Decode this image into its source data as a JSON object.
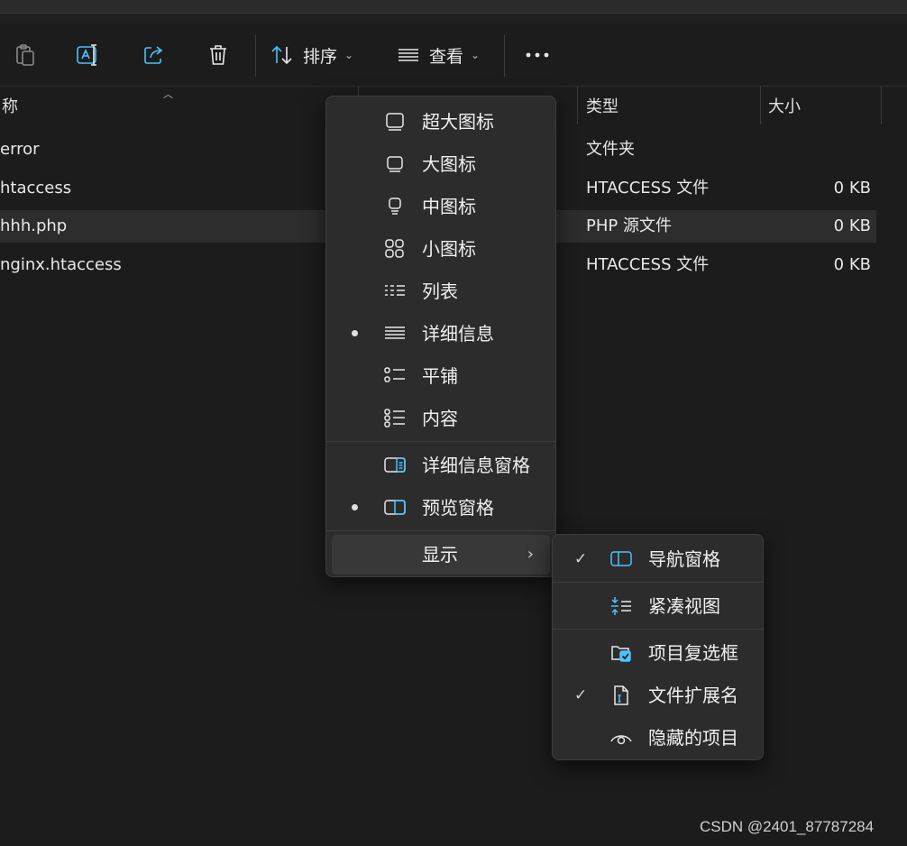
{
  "toolbar": {
    "sort_label": "排序",
    "view_label": "查看"
  },
  "columns": {
    "name": "称",
    "type": "类型",
    "size": "大小"
  },
  "files": [
    {
      "name": "error",
      "type": "文件夹",
      "size": ""
    },
    {
      "name": "htaccess",
      "type": "HTACCESS 文件",
      "size": "0 KB"
    },
    {
      "name": "hhh.php",
      "type": "PHP 源文件",
      "size": "0 KB"
    },
    {
      "name": "nginx.htaccess",
      "type": "HTACCESS 文件",
      "size": "0 KB"
    }
  ],
  "view_menu": {
    "items": [
      {
        "label": "超大图标",
        "icon": "extra-large-icons-icon"
      },
      {
        "label": "大图标",
        "icon": "large-icons-icon"
      },
      {
        "label": "中图标",
        "icon": "medium-icons-icon"
      },
      {
        "label": "小图标",
        "icon": "small-icons-icon"
      },
      {
        "label": "列表",
        "icon": "list-icon"
      },
      {
        "label": "详细信息",
        "icon": "details-icon",
        "selected": true
      },
      {
        "label": "平铺",
        "icon": "tiles-icon"
      },
      {
        "label": "内容",
        "icon": "content-icon"
      },
      {
        "label": "详细信息窗格",
        "icon": "details-pane-icon"
      },
      {
        "label": "预览窗格",
        "icon": "preview-pane-icon",
        "selected": true
      },
      {
        "label": "显示",
        "icon": "",
        "has_submenu": true
      }
    ]
  },
  "show_submenu": {
    "items": [
      {
        "label": "导航窗格",
        "icon": "navigation-pane-icon",
        "checked": true
      },
      {
        "label": "紧凑视图",
        "icon": "compact-view-icon",
        "checked": false
      },
      {
        "label": "项目复选框",
        "icon": "item-checkbox-icon",
        "checked": false
      },
      {
        "label": "文件扩展名",
        "icon": "file-extension-icon",
        "checked": true
      },
      {
        "label": "隐藏的项目",
        "icon": "hidden-items-icon",
        "checked": false
      }
    ],
    "check_glyph": "✓"
  },
  "watermark": "CSDN @2401_87787284",
  "colors": {
    "background": "#1c1c1c",
    "menu_bg": "#2c2c2c",
    "accent_blue": "#4cc2ff"
  }
}
